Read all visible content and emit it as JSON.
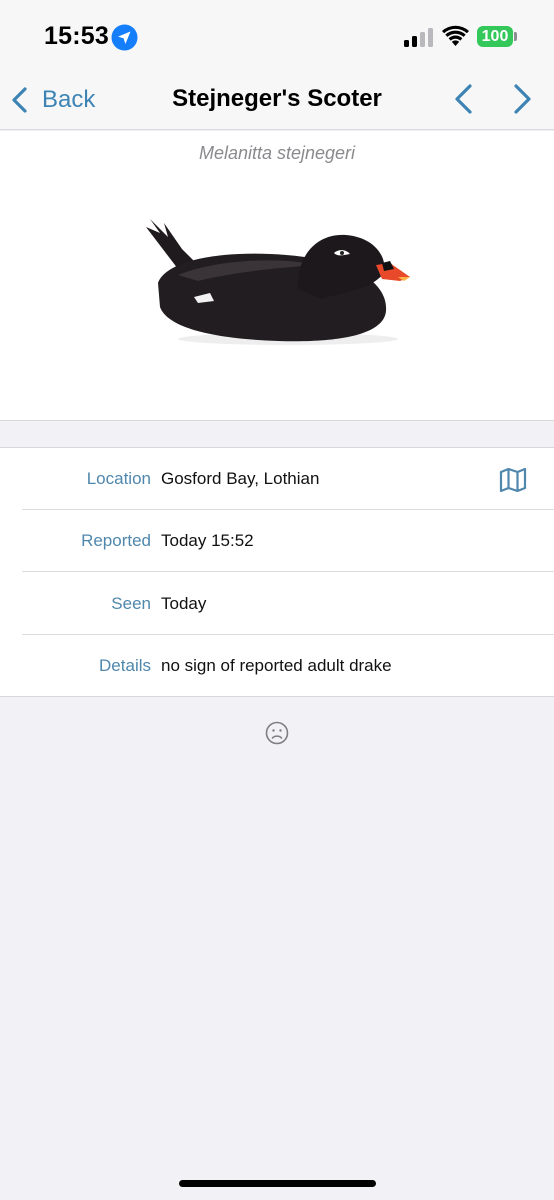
{
  "status_bar": {
    "time": "15:53",
    "battery": "100",
    "location_icon": "location-arrow-icon",
    "signal_icon": "cellular-signal-icon",
    "wifi_icon": "wifi-icon"
  },
  "nav": {
    "back_label": "Back",
    "title": "Stejneger's Scoter",
    "prev_icon": "chevron-left-icon",
    "next_icon": "chevron-right-icon"
  },
  "species": {
    "scientific_name": "Melanitta stejnegeri",
    "image_icon": "scoter-duck-illustration"
  },
  "details": {
    "rows": [
      {
        "label": "Location",
        "value": "Gosford Bay, Lothian",
        "icon": "map-icon"
      },
      {
        "label": "Reported",
        "value": "Today 15:52"
      },
      {
        "label": "Seen",
        "value": "Today"
      },
      {
        "label": "Details",
        "value": "no sign of reported adult drake"
      }
    ]
  },
  "footer_icon": "sad-face-icon",
  "colors": {
    "accent": "#3d84b5",
    "label": "#4f87ad",
    "background": "#f1f1f6",
    "battery": "#34c759"
  }
}
